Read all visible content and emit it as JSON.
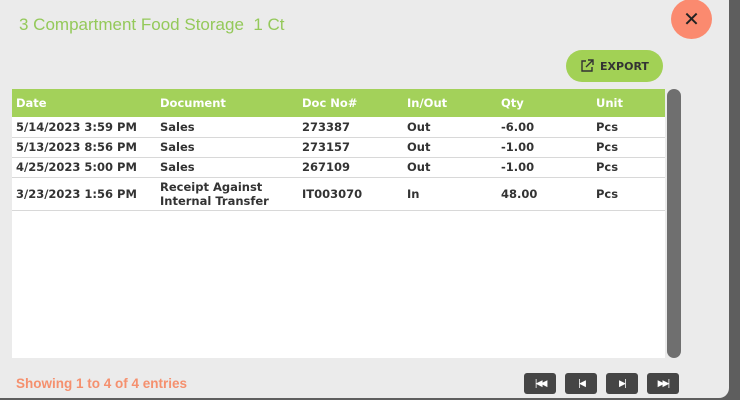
{
  "title": "3 Compartment Food Storage  1 Ct",
  "close_label": "✕",
  "export_label": "EXPORT",
  "columns": [
    "Date",
    "Document",
    "Doc No#",
    "In/Out",
    "Qty",
    "Unit"
  ],
  "rows": [
    [
      "5/14/2023 3:59 PM",
      "Sales",
      "273387",
      "Out",
      "-6.00",
      "Pcs"
    ],
    [
      "5/13/2023 8:56 PM",
      "Sales",
      "273157",
      "Out",
      "-1.00",
      "Pcs"
    ],
    [
      "4/25/2023 5:00 PM",
      "Sales",
      "267109",
      "Out",
      "-1.00",
      "Pcs"
    ],
    [
      "3/23/2023 1:56 PM",
      "Receipt Against Internal Transfer",
      "IT003070",
      "In",
      "48.00",
      "Pcs"
    ]
  ],
  "footer": "Showing 1 to 4 of 4 entries",
  "pager": {
    "first": "|◀◀",
    "prev": "|◀",
    "next": "▶|",
    "last": "▶▶|"
  }
}
